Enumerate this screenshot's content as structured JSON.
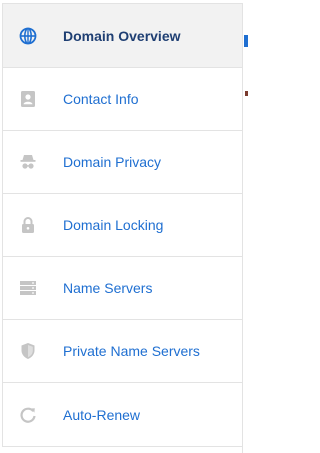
{
  "nav": {
    "items": [
      {
        "label": "Domain Overview",
        "icon": "globe-icon",
        "active": true
      },
      {
        "label": "Contact Info",
        "icon": "contact-card-icon"
      },
      {
        "label": "Domain Privacy",
        "icon": "incognito-icon"
      },
      {
        "label": "Domain Locking",
        "icon": "lock-icon"
      },
      {
        "label": "Name Servers",
        "icon": "server-icon"
      },
      {
        "label": "Private Name Servers",
        "icon": "shield-icon"
      },
      {
        "label": "Auto-Renew",
        "icon": "refresh-icon"
      }
    ]
  },
  "colors": {
    "link": "#1f6fd1",
    "active_text": "#1f3f73",
    "active_bg": "#f2f2f2",
    "icon_muted": "#c5c5c5",
    "divider": "#e3e3e3"
  }
}
